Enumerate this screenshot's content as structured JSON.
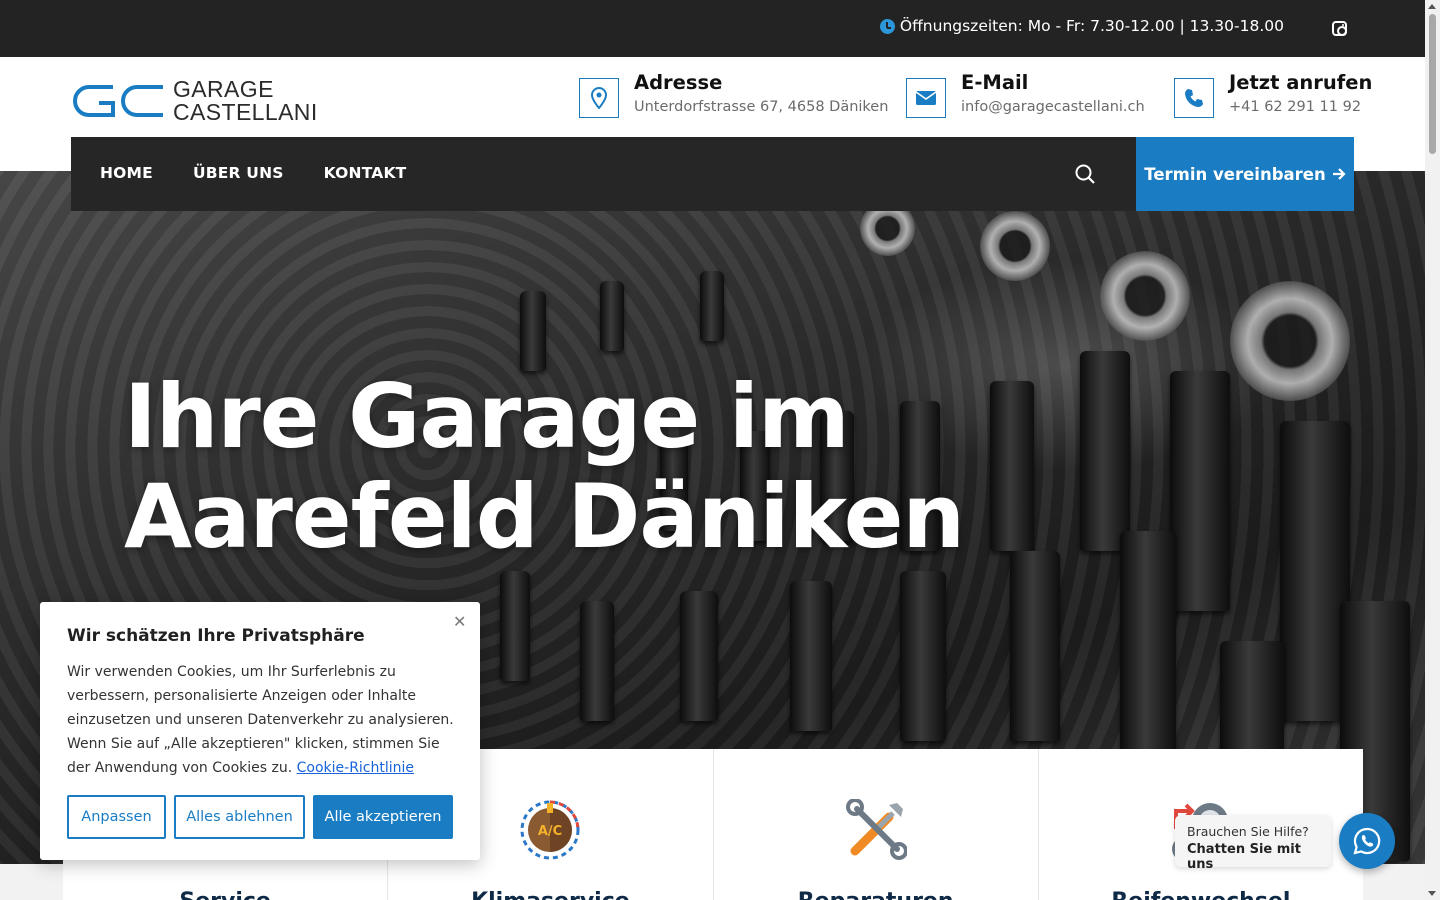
{
  "topbar": {
    "hours": "Öffnungszeiten: Mo - Fr: 7.30-12.00 | 13.30-18.00",
    "social_icon": "instagram-icon"
  },
  "logo": {
    "line1": "GARAGE",
    "line2": "CASTELLANI",
    "mark": "GC"
  },
  "contact": {
    "address": {
      "title": "Adresse",
      "value": "Unterdorfstrasse 67, 4658 Däniken",
      "icon": "map-pin-icon"
    },
    "email": {
      "title": "E-Mail",
      "value": "info@garagecastellani.ch",
      "icon": "envelope-icon"
    },
    "phone": {
      "title": "Jetzt anrufen",
      "value": "+41 62 291 11 92",
      "icon": "phone-icon"
    }
  },
  "nav": {
    "items": [
      "HOME",
      "ÜBER UNS",
      "KONTAKT"
    ],
    "cta": "Termin vereinbaren"
  },
  "hero": {
    "line1": "Ihre Garage im",
    "line2": "Aarefeld Däniken"
  },
  "services": [
    {
      "title": "Service",
      "icon": "service-icon"
    },
    {
      "title": "Klimaservice",
      "icon": "air-conditioning-icon"
    },
    {
      "title": "Reparaturen",
      "icon": "tools-icon"
    },
    {
      "title": "Reifenwechsel",
      "icon": "tire-icon"
    }
  ],
  "cookie": {
    "title": "Wir schätzen Ihre Privatsphäre",
    "text": "Wir verwenden Cookies, um Ihr Surferlebnis zu verbessern, personalisierte Anzeigen oder Inhalte einzusetzen und unseren Datenverkehr zu analysieren. Wenn Sie auf „Alle akzeptieren\" klicken, stimmen Sie der Anwendung von Cookies zu.",
    "link": "Cookie-Richtlinie",
    "buttons": {
      "customize": "Anpassen",
      "reject": "Alles ablehnen",
      "accept": "Alle akzeptieren"
    }
  },
  "chat": {
    "line1": "Brauchen Sie Hilfe?",
    "line2": "Chatten Sie mit uns"
  },
  "colors": {
    "accent": "#1a7dc3",
    "dark": "#262626",
    "topbar": "#232323"
  }
}
